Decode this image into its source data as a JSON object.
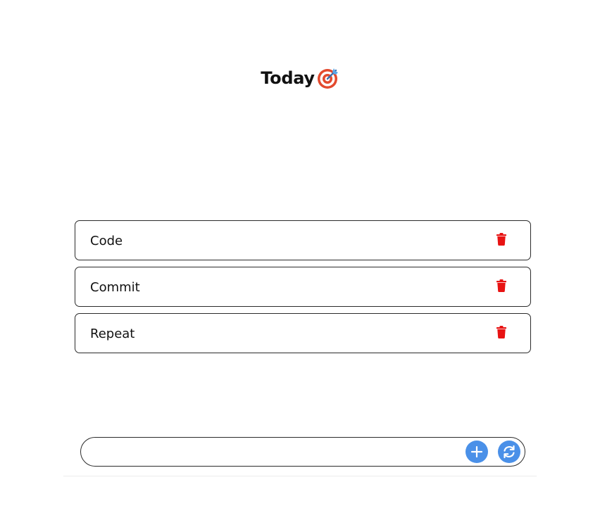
{
  "header": {
    "title": "Today",
    "icon": "target-icon"
  },
  "tasks": [
    {
      "label": "Code",
      "delete_icon": "trash-icon"
    },
    {
      "label": "Commit",
      "delete_icon": "trash-icon"
    },
    {
      "label": "Repeat",
      "delete_icon": "trash-icon"
    }
  ],
  "input_bar": {
    "value": "",
    "placeholder": "",
    "add_icon": "plus-icon",
    "refresh_icon": "refresh-icon"
  },
  "colors": {
    "delete": "#e81313",
    "accent": "#4a90e8",
    "border": "#2b2b2b",
    "target_red": "#e34a2e"
  }
}
